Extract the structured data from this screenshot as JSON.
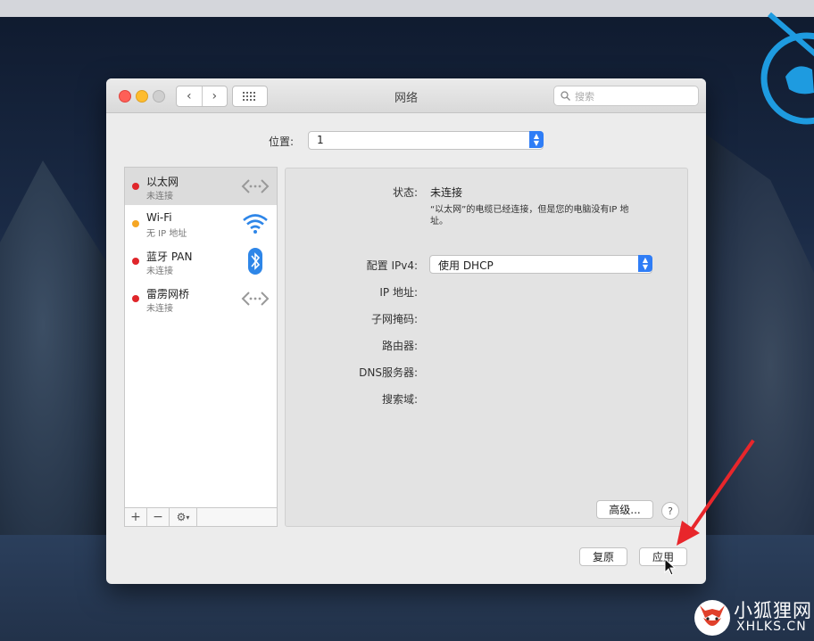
{
  "window": {
    "title": "网络",
    "search_placeholder": "搜索"
  },
  "location": {
    "label": "位置:",
    "value": "1"
  },
  "services": [
    {
      "name": "以太网",
      "status": "未连接",
      "dot_color": "#e0262b",
      "icon": "ethernet-arrows-icon",
      "selected": true
    },
    {
      "name": "Wi-Fi",
      "status": "无 IP 地址",
      "dot_color": "#f5a623",
      "icon": "wifi-icon",
      "selected": false
    },
    {
      "name": "蓝牙 PAN",
      "status": "未连接",
      "dot_color": "#e0262b",
      "icon": "bluetooth-icon",
      "selected": false
    },
    {
      "name": "雷雳网桥",
      "status": "未连接",
      "dot_color": "#e0262b",
      "icon": "ethernet-arrows-icon",
      "selected": false
    }
  ],
  "sidebar_footer": {
    "add": "+",
    "remove": "−",
    "gear": "⚙"
  },
  "detail": {
    "status_label": "状态:",
    "status_value": "未连接",
    "status_note": "“以太网”的电缆已经连接，但是您的电脑没有IP 地址。",
    "ipv4_label": "配置 IPv4:",
    "ipv4_value": "使用 DHCP",
    "ip_label": "IP 地址:",
    "subnet_label": "子网掩码:",
    "router_label": "路由器:",
    "dns_label": "DNS服务器:",
    "search_domain_label": "搜索域:",
    "advanced_button": "高级...",
    "help_button": "?"
  },
  "footer": {
    "revert_button": "复原",
    "apply_button": "应用"
  },
  "watermark": {
    "cn": "小狐狸网",
    "en": "XHLKS.CN"
  },
  "colors": {
    "accent": "#2f7df6",
    "status_red": "#e0262b",
    "status_yellow": "#f5a623",
    "annotation_arrow": "#e8262b"
  }
}
